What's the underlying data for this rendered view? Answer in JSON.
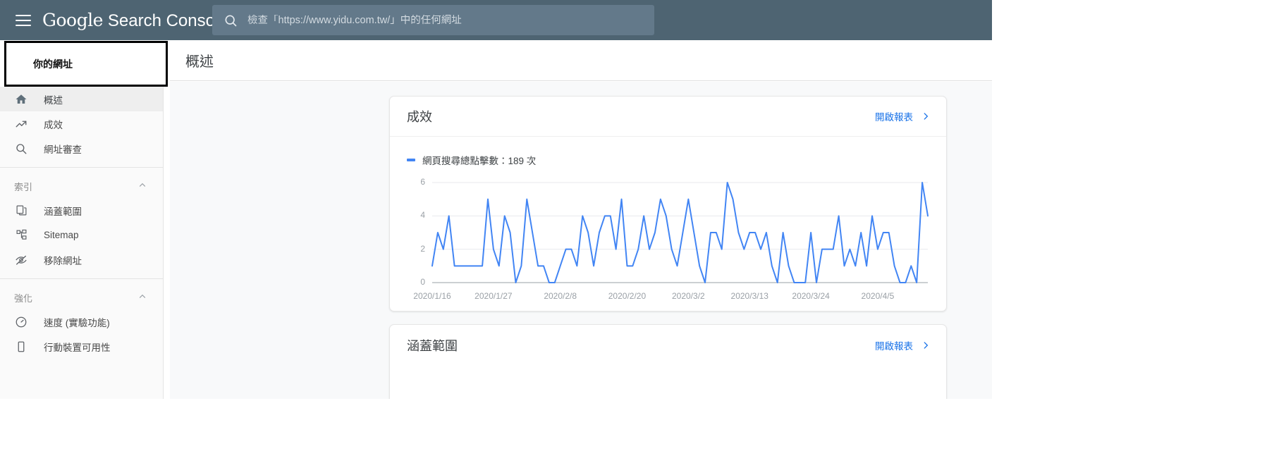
{
  "topbar": {
    "menu_icon": "hamburger-icon",
    "brand_google": "Google",
    "brand_product": "Search Console",
    "search": {
      "icon": "search-icon",
      "placeholder": "檢查「https://www.yidu.com.tw/」中的任何網址",
      "value": ""
    }
  },
  "property": {
    "label": "你的網址"
  },
  "sidebar": {
    "items": [
      {
        "label": "概述",
        "icon": "home-icon",
        "active": true
      },
      {
        "label": "成效",
        "icon": "trending-up-icon",
        "active": false
      },
      {
        "label": "網址審查",
        "icon": "search-icon",
        "active": false
      }
    ],
    "sections": [
      {
        "title": "索引",
        "collapse_icon": "chevron-up-icon",
        "items": [
          {
            "label": "涵蓋範圍",
            "icon": "pages-icon"
          },
          {
            "label": "Sitemap",
            "icon": "sitemap-icon"
          },
          {
            "label": "移除網址",
            "icon": "eye-off-icon"
          }
        ]
      },
      {
        "title": "強化",
        "collapse_icon": "chevron-up-icon",
        "items": [
          {
            "label": "速度 (實驗功能)",
            "icon": "speed-gauge-icon"
          },
          {
            "label": "行動裝置可用性",
            "icon": "mobile-phone-icon"
          }
        ]
      }
    ]
  },
  "content": {
    "page_title": "概述",
    "cards": [
      {
        "title": "成效",
        "open_report_label": "開啟報表",
        "open_report_icon": "chevron-right-icon",
        "legend_label": "網頁搜尋總點擊數：189 次"
      },
      {
        "title": "涵蓋範圍",
        "open_report_label": "開啟報表",
        "open_report_icon": "chevron-right-icon"
      }
    ]
  },
  "colors": {
    "topbar_bg": "#4e6472",
    "search_bg": "#63798a",
    "accent_link": "#1a73e8",
    "chart_line": "#4285f4",
    "sidebar_bg": "#fafafa",
    "main_bg": "#f8f9fa"
  },
  "chart_data": {
    "type": "line",
    "title": "成效",
    "series_name": "網頁搜尋總點擊數：189 次",
    "line_color": "#4285f4",
    "xlabel": "",
    "ylabel": "",
    "ylim": [
      0,
      6
    ],
    "yticks": [
      0,
      2,
      4,
      6
    ],
    "grid": true,
    "legend_position": "top-left",
    "xticks": [
      "2020/1/16",
      "2020/1/27",
      "2020/2/8",
      "2020/2/20",
      "2020/3/2",
      "2020/3/13",
      "2020/3/24",
      "2020/4/5"
    ],
    "xtick_indices": [
      0,
      11,
      23,
      35,
      46,
      57,
      68,
      80
    ],
    "values": [
      1,
      3,
      2,
      4,
      1,
      1,
      1,
      1,
      1,
      1,
      5,
      2,
      1,
      4,
      3,
      0,
      1,
      5,
      3,
      1,
      1,
      0,
      0,
      1,
      2,
      2,
      1,
      4,
      3,
      1,
      3,
      4,
      4,
      2,
      5,
      1,
      1,
      2,
      4,
      2,
      3,
      5,
      4,
      2,
      1,
      3,
      5,
      3,
      1,
      0,
      3,
      3,
      2,
      6,
      5,
      3,
      2,
      3,
      3,
      2,
      3,
      1,
      0,
      3,
      1,
      0,
      0,
      0,
      3,
      0,
      2,
      2,
      2,
      4,
      1,
      2,
      1,
      3,
      1,
      4,
      2,
      3,
      3,
      1,
      0,
      0,
      1,
      0,
      6,
      4
    ]
  }
}
